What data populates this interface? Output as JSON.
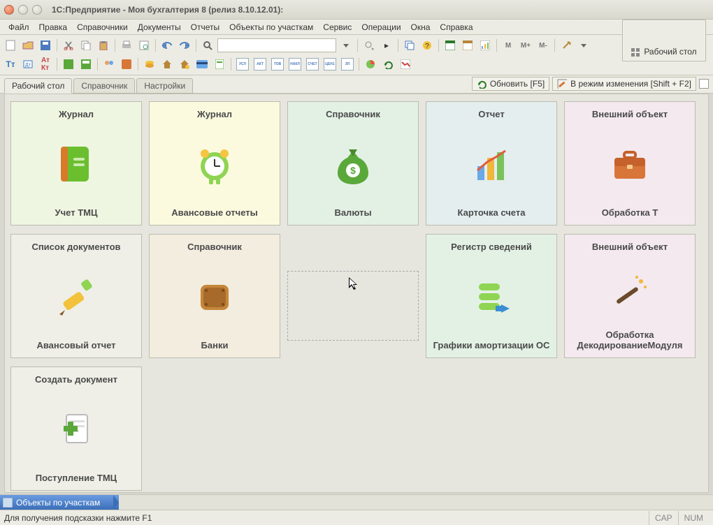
{
  "window": {
    "title": "1С:Предприятие - Моя бухгалтерия 8 (релиз 8.10.12.01):"
  },
  "menu": [
    "Файл",
    "Правка",
    "Справочники",
    "Документы",
    "Отчеты",
    "Объекты по участкам",
    "Сервис",
    "Операции",
    "Окна",
    "Справка"
  ],
  "desktop_widget": {
    "label": "Рабочий стол"
  },
  "workspace": {
    "tabs": [
      "Рабочий стол",
      "Справочник",
      "Настройки"
    ],
    "refresh": "Обновить [F5]",
    "edit_mode": "В режим изменения [Shift + F2]"
  },
  "cards": [
    {
      "cat": "Журнал",
      "name": "Учет ТМЦ",
      "tone": "tone-green",
      "icon": "journal"
    },
    {
      "cat": "Журнал",
      "name": "Авансовые отчеты",
      "tone": "tone-yellow",
      "icon": "clock"
    },
    {
      "cat": "Справочник",
      "name": "Валюты",
      "tone": "tone-mint",
      "icon": "moneybag"
    },
    {
      "cat": "Отчет",
      "name": "Карточка счета",
      "tone": "tone-blue",
      "icon": "barchart"
    },
    {
      "cat": "Внешний объект",
      "name": "Обработка  Т",
      "tone": "tone-pink",
      "icon": "briefcase"
    },
    {
      "cat": "Список документов",
      "name": "Авансовый отчет",
      "tone": "tone-grey",
      "icon": "pencil"
    },
    {
      "cat": "Справочник",
      "name": "Банки",
      "tone": "tone-cream",
      "icon": "crate"
    },
    {
      "cat": "",
      "name": "",
      "tone": "empty",
      "icon": "none"
    },
    {
      "cat": "Регистр сведений",
      "name": "Графики амортизации ОС",
      "tone": "tone-mint",
      "icon": "stack-arrow"
    },
    {
      "cat": "Внешний объект",
      "name": "Обработка ДекодированиеМодуля",
      "tone": "tone-pink",
      "icon": "wand"
    },
    {
      "cat": "Создать документ",
      "name": "Поступление ТМЦ",
      "tone": "tone-grey",
      "icon": "new-doc"
    }
  ],
  "taskbar": {
    "item": "Объекты по участкам"
  },
  "status": {
    "hint": "Для получения подсказки нажмите F1",
    "cap": "CAP",
    "num": "NUM"
  },
  "toolbar2_labels": [
    "УСЛ",
    "АКТ",
    "ТОВ",
    "НАКЛ",
    "СЧЕТ",
    "ЦЕН1",
    "ЗП"
  ]
}
